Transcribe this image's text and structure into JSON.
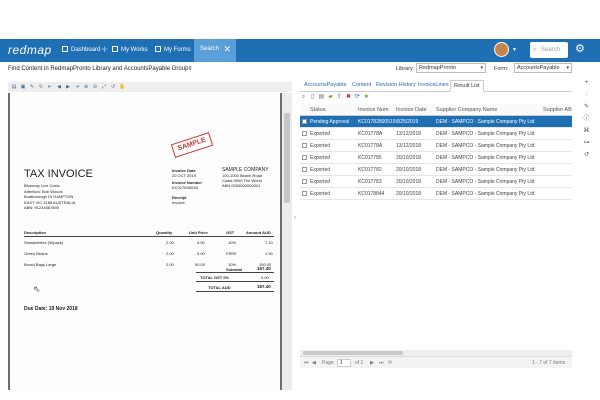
{
  "app": {
    "logo": "redmap",
    "nav": [
      {
        "label": "Dashboard",
        "icon": "home-icon"
      },
      {
        "label": "My Works",
        "icon": "briefcase-icon"
      },
      {
        "label": "My Forms",
        "icon": "forms-icon"
      }
    ],
    "active_tab": "Search",
    "search_placeholder": "Search"
  },
  "header": {
    "title": "Find Content in RedmapPronto Library and AccountsPayable Group",
    "library_label": "Library:",
    "library_value": "RedmapPronto",
    "form_label": "Form:",
    "form_value": "AccountsPayable"
  },
  "invoice": {
    "stamp": "SAMPLE",
    "title": "TAX INVOICE",
    "bill_to": [
      "Bluemap Live Costs",
      "Attention: Bob Woods",
      "Boatborough Dr HAMPTON",
      "EAST VIC 3188 AUSTRALIA",
      "ABN: 91234567890"
    ],
    "date_label": "Invoice Date",
    "date_value": "20 OCT 2019",
    "number_label": "Invoice Number",
    "number_value": "KC01782801B",
    "receipt_label": "Receipt",
    "receipt_value": "Invoice",
    "company": [
      "SAMPLE COMPANY",
      "100-1000 Beach Road",
      "Coast 3000 The World",
      "ABN 0000000000001"
    ],
    "columns": [
      "Description",
      "Quantity",
      "Unit Price",
      "GST",
      "Amount AUD"
    ],
    "lines": [
      {
        "desc": "Strawberries (50pack)",
        "qty": "2.00",
        "price": "3.50",
        "gst": "10%",
        "amount": "7.10"
      },
      {
        "desc": "Green Beans",
        "qty": "2.00",
        "price": "3.00",
        "gst": "FREE",
        "amount": "1.90"
      },
      {
        "desc": "Broad Bags Large",
        "qty": "2.00",
        "price": "50.00",
        "gst": "10%",
        "amount": "150.00"
      }
    ],
    "subtotal_label": "Subtotal",
    "subtotal_value": "167.40",
    "gst_label": "TOTAL GST 0%",
    "gst_value": "0.00",
    "total_label": "TOTAL AUD",
    "total_value": "167.40",
    "due_date": "Due Date: 19 Nov 2018"
  },
  "tabs": [
    "AccountsPayable",
    "Content",
    "Revision History",
    "InvoiceLines",
    "Result List"
  ],
  "active_result_tab": "Result List",
  "grid": {
    "columns": [
      "Status",
      "Invoice Num",
      "Invoice Date",
      "Supplier Company Name",
      "Supplier AB"
    ],
    "rows": [
      {
        "status": "Pending Approval",
        "num": "KC01782800519",
        "date": "8/25/2019",
        "supplier": "DEM - SAMPCO - Sample Company Pty Ltd",
        "selected": true
      },
      {
        "status": "Exported",
        "num": "KC01778A",
        "date": "13/12/2018",
        "supplier": "DEM - SAMPCO - Sample Company Pty Ltd",
        "selected": false
      },
      {
        "status": "Exported",
        "num": "KC01778A",
        "date": "13/12/2018",
        "supplier": "DEM - SAMPCO - Sample Company Pty Ltd",
        "selected": false
      },
      {
        "status": "Exported",
        "num": "KC017785",
        "date": "20/10/2018",
        "supplier": "DEM - SAMPCO - Sample Company Pty Ltd",
        "selected": false
      },
      {
        "status": "Exported",
        "num": "KC017782",
        "date": "20/10/2018",
        "supplier": "DEM - SAMPCO - Sample Company Pty Ltd",
        "selected": false
      },
      {
        "status": "Exported",
        "num": "KC017783",
        "date": "20/10/2018",
        "supplier": "DEM - SAMPCO - Sample Company Pty Ltd",
        "selected": false
      },
      {
        "status": "Exported",
        "num": "KC0178844",
        "date": "20/10/2018",
        "supplier": "DEM - SAMPCO - Sample Company Pty Ltd",
        "selected": false
      }
    ]
  },
  "pager": {
    "page_label": "Page",
    "page_value": "1",
    "of_label": "of 1",
    "summary": "1 - 7 of 7 items"
  },
  "colors": {
    "primary": "#1f6fb5",
    "stamp": "#c83a3a",
    "viewer_bg": "#6e6e6e"
  }
}
